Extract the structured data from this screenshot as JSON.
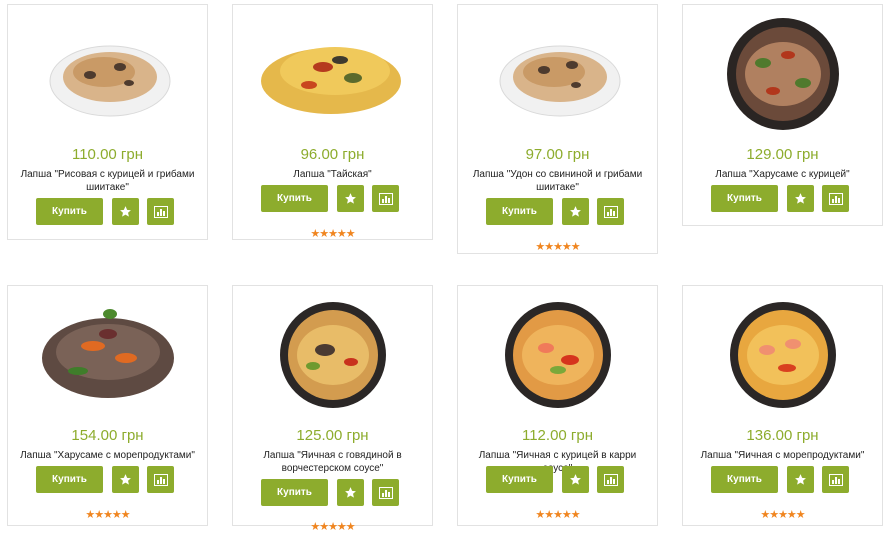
{
  "products": [
    {
      "price": "110.00 грн",
      "name": "Лапша \"Рисовая с курицей и грибами шиитаке\"",
      "buy": "Купить",
      "rating": 0
    },
    {
      "price": "96.00 грн",
      "name": "Лапша \"Тайская\"",
      "buy": "Купить",
      "rating": 5,
      "stars": "★★★★★"
    },
    {
      "price": "97.00 грн",
      "name": "Лапша \"Удон со свининой и грибами шиитаке\"",
      "buy": "Купить",
      "rating": 5,
      "stars": "★★★★★"
    },
    {
      "price": "129.00 грн",
      "name": "Лапша \"Харусаме с курицей\"",
      "buy": "Купить",
      "rating": 0
    },
    {
      "price": "154.00 грн",
      "name": "Лапша \"Харусаме с морепродуктами\"",
      "buy": "Купить",
      "rating": 5,
      "stars": "★★★★★"
    },
    {
      "price": "125.00 грн",
      "name": "Лапша \"Яичная с говядиной в ворчестерском соусе\"",
      "buy": "Купить",
      "rating": 5,
      "stars": "★★★★★"
    },
    {
      "price": "112.00 грн",
      "name": "Лапша \"Яичная с курицей в карри соусе\"",
      "buy": "Купить",
      "rating": 5,
      "stars": "★★★★★"
    },
    {
      "price": "136.00 грн",
      "name": "Лапша \"Яичная с морепродуктами\"",
      "buy": "Купить",
      "rating": 5,
      "stars": "★★★★★"
    }
  ],
  "icons": {
    "favorite": "star-icon",
    "compare": "bar-chart-icon"
  },
  "colors": {
    "accent": "#8dac2d",
    "stars": "#f0851f"
  }
}
